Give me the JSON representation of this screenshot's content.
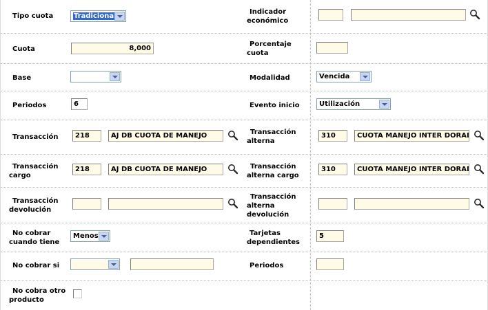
{
  "labels": {
    "tipo_cuota": "Tipo cuota",
    "indicador_l1": "Indicador",
    "indicador_l2": "económico",
    "cuota": "Cuota",
    "porcentaje_l1": "Porcentaje",
    "porcentaje_l2": "cuota",
    "base": "Base",
    "modalidad": "Modalidad",
    "periodos": "Periodos",
    "evento_inicio": "Evento inicio",
    "transaccion": "Transacción",
    "trans_alterna_l1": "Transacción",
    "trans_alterna_l2": "alterna",
    "trans_cargo_l1": "Transacción",
    "trans_cargo_l2": "cargo",
    "trans_alt_cargo_l1": "Transacción",
    "trans_alt_cargo_l2": "alterna cargo",
    "trans_dev_l1": "Transacción",
    "trans_dev_l2": "devolución",
    "trans_alt_dev_l1": "Transacción",
    "trans_alt_dev_l2": "alterna",
    "trans_alt_dev_l3": "devolución",
    "no_cobrar_tiene_l1": "No cobrar",
    "no_cobrar_tiene_l2": "cuando tiene",
    "tarjetas_l1": "Tarjetas",
    "tarjetas_l2": "dependientes",
    "no_cobrar_si": "No cobrar si",
    "periodos2": "Periodos",
    "no_cobra_otro_l1": "No cobra otro",
    "no_cobra_otro_l2": "producto"
  },
  "values": {
    "tipo_cuota": "Tradicional",
    "indicador_code": "",
    "indicador_desc": "",
    "cuota": "8,000",
    "porcentaje": "",
    "base": "",
    "modalidad": "Vencida",
    "periodos": "6",
    "evento_inicio": "Utilización",
    "trans_code": "218",
    "trans_desc": "AJ DB CUOTA DE MANEJO",
    "trans_alt_code": "310",
    "trans_alt_desc": "CUOTA MANEJO INTER DORADA",
    "trans_cargo_code": "218",
    "trans_cargo_desc": "AJ DB CUOTA DE MANEJO",
    "trans_alt_cargo_code": "310",
    "trans_alt_cargo_desc": "CUOTA MANEJO INTER DORADA",
    "trans_dev_code": "",
    "trans_dev_desc": "",
    "trans_alt_dev_code": "",
    "trans_alt_dev_desc": "",
    "no_cobrar_tiene": "Menos",
    "tarjetas": "5",
    "no_cobrar_si": "",
    "no_cobrar_si_value": "",
    "periodos2": "",
    "no_cobra_otro_checked": false
  },
  "icons": {
    "lookup": "magnifier-icon",
    "dropdown": "chevron-down-icon"
  }
}
